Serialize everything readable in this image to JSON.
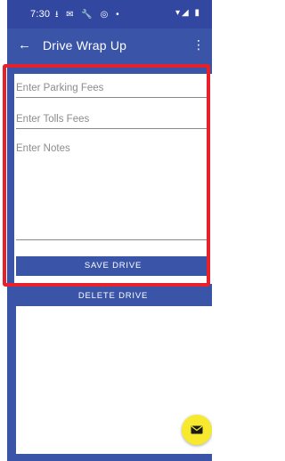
{
  "status_bar": {
    "time": "7:30",
    "left_icons": "⭳ ✉ 🔧 ◎ •",
    "right_icons": "▾◢ ▮"
  },
  "app_bar": {
    "back_icon": "arrow-left-icon",
    "title": "Drive Wrap Up",
    "more_icon": "more-vertical-icon"
  },
  "form": {
    "parking_placeholder": "Enter Parking Fees",
    "parking_value": "",
    "tolls_placeholder": "Enter Tolls Fees",
    "tolls_value": "",
    "notes_placeholder": "Enter Notes",
    "notes_value": "",
    "save_label": "SAVE DRIVE"
  },
  "delete_label": "DELETE DRIVE",
  "fab_icon": "mail-icon",
  "colors": {
    "primary": "#3a54a8",
    "status_bar": "#3248a0",
    "fab": "#f7e92e",
    "highlight": "#e8202a"
  }
}
